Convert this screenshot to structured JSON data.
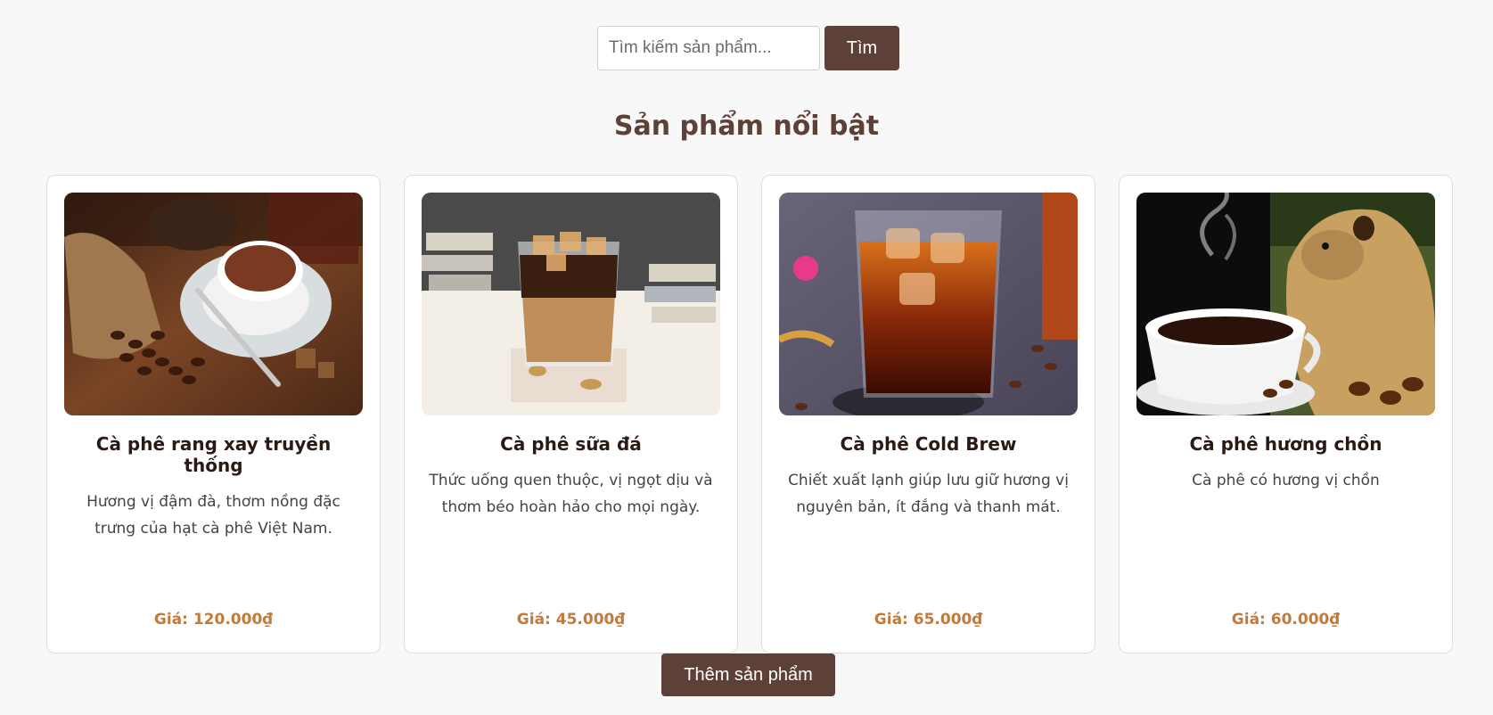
{
  "search": {
    "placeholder": "Tìm kiếm sản phẩm...",
    "button_label": "Tìm"
  },
  "section": {
    "title": "Sản phẩm nổi bật"
  },
  "products": [
    {
      "name": "Cà phê rang xay truyền thống",
      "description": "Hương vị đậm đà, thơm nồng đặc trưng của hạt cà phê Việt Nam.",
      "price": "Giá: 120.000₫",
      "image": "traditional-coffee-photo"
    },
    {
      "name": "Cà phê sữa đá",
      "description": "Thức uống quen thuộc, vị ngọt dịu và thơm béo hoàn hảo cho mọi ngày.",
      "price": "Giá: 45.000₫",
      "image": "iced-milk-coffee-photo"
    },
    {
      "name": "Cà phê Cold Brew",
      "description": "Chiết xuất lạnh giúp lưu giữ hương vị nguyên bản, ít đắng và thanh mát.",
      "price": "Giá: 65.000₫",
      "image": "cold-brew-photo"
    },
    {
      "name": "Cà phê hương chồn",
      "description": "Cà phê có hương vị chồn",
      "price": "Giá: 60.000₫",
      "image": "weasel-coffee-photo"
    }
  ],
  "actions": {
    "add_product_label": "Thêm sản phẩm"
  },
  "colors": {
    "brand": "#5d4037",
    "price": "#c17a3a",
    "background": "#f8f8f8"
  }
}
